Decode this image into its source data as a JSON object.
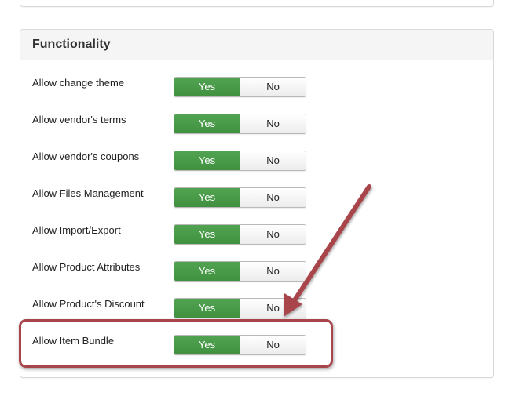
{
  "panel": {
    "title": "Functionality"
  },
  "rows": [
    {
      "label": "Allow change theme",
      "yes": "Yes",
      "no": "No",
      "selected": "Yes"
    },
    {
      "label": "Allow vendor's terms",
      "yes": "Yes",
      "no": "No",
      "selected": "Yes"
    },
    {
      "label": "Allow vendor's coupons",
      "yes": "Yes",
      "no": "No",
      "selected": "Yes"
    },
    {
      "label": "Allow Files Management",
      "yes": "Yes",
      "no": "No",
      "selected": "Yes"
    },
    {
      "label": "Allow Import/Export",
      "yes": "Yes",
      "no": "No",
      "selected": "Yes"
    },
    {
      "label": "Allow Product Attributes",
      "yes": "Yes",
      "no": "No",
      "selected": "Yes"
    },
    {
      "label": "Allow Product's Discount",
      "yes": "Yes",
      "no": "No",
      "selected": "Yes"
    },
    {
      "label": "Allow Item Bundle",
      "yes": "Yes",
      "no": "No",
      "selected": "Yes"
    }
  ],
  "colors": {
    "yes_active": "#47a447",
    "annotation": "#a8444b"
  }
}
